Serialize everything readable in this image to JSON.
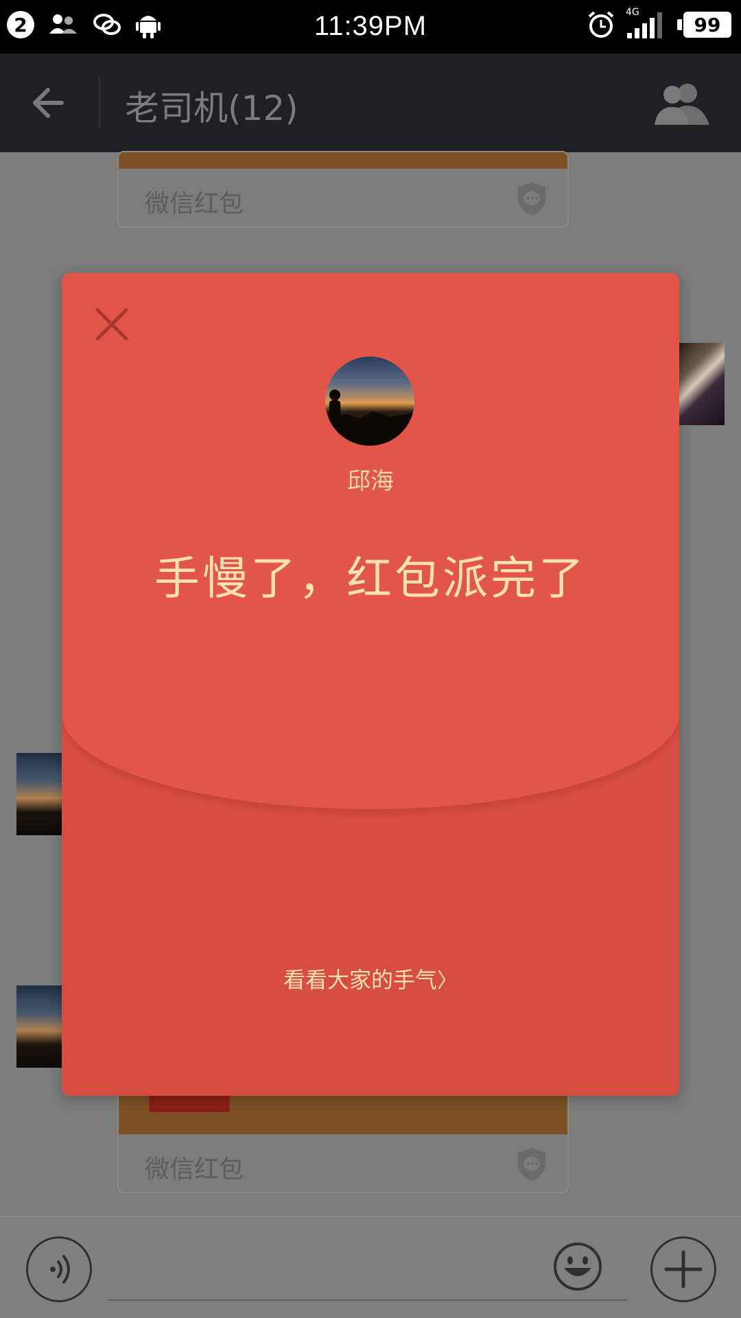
{
  "status_bar": {
    "notification_count": "2",
    "time": "11:39PM",
    "network": "4G",
    "battery": "99"
  },
  "header": {
    "title": "老司机(12)"
  },
  "chat": {
    "messages": [
      {
        "type": "red-packet",
        "label": "微信红包"
      },
      {
        "type": "red-packet",
        "label": "微信红包"
      }
    ]
  },
  "red_packet_modal": {
    "sender_name": "邱海",
    "status": "手慢了，红包派完了",
    "details_link": "看看大家的手气",
    "details_arrow": "〉"
  },
  "icons": {
    "back": "back-arrow-icon",
    "members": "group-members-icon",
    "close": "close-icon",
    "voice": "voice-icon",
    "emoji": "emoji-icon",
    "plus": "plus-icon"
  },
  "colors": {
    "modal_top": "#e2564a",
    "modal_bottom": "#d84d41",
    "gold_text": "#fbe0b0",
    "header_bg": "#202022"
  }
}
